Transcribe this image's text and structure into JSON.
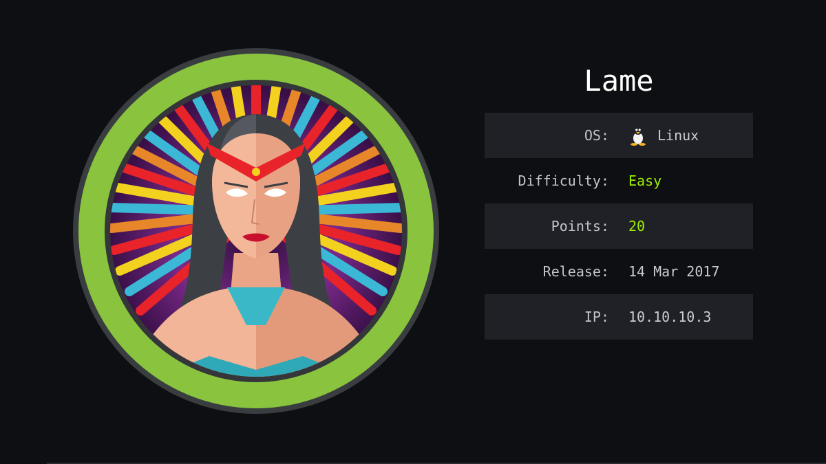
{
  "machine": {
    "name": "Lame",
    "rows": [
      {
        "label": "OS:",
        "value": "Linux",
        "icon": "linux-penguin-icon"
      },
      {
        "label": "Difficulty:",
        "value": "Easy"
      },
      {
        "label": "Points:",
        "value": "20"
      },
      {
        "label": "Release:",
        "value": "14 Mar 2017"
      },
      {
        "label": "IP:",
        "value": "10.10.10.3"
      }
    ]
  },
  "colors": {
    "background": "#0e0f12",
    "row_shade": "#1f2126",
    "accent_green": "#9fef00",
    "ring_green": "#8ac43f"
  }
}
